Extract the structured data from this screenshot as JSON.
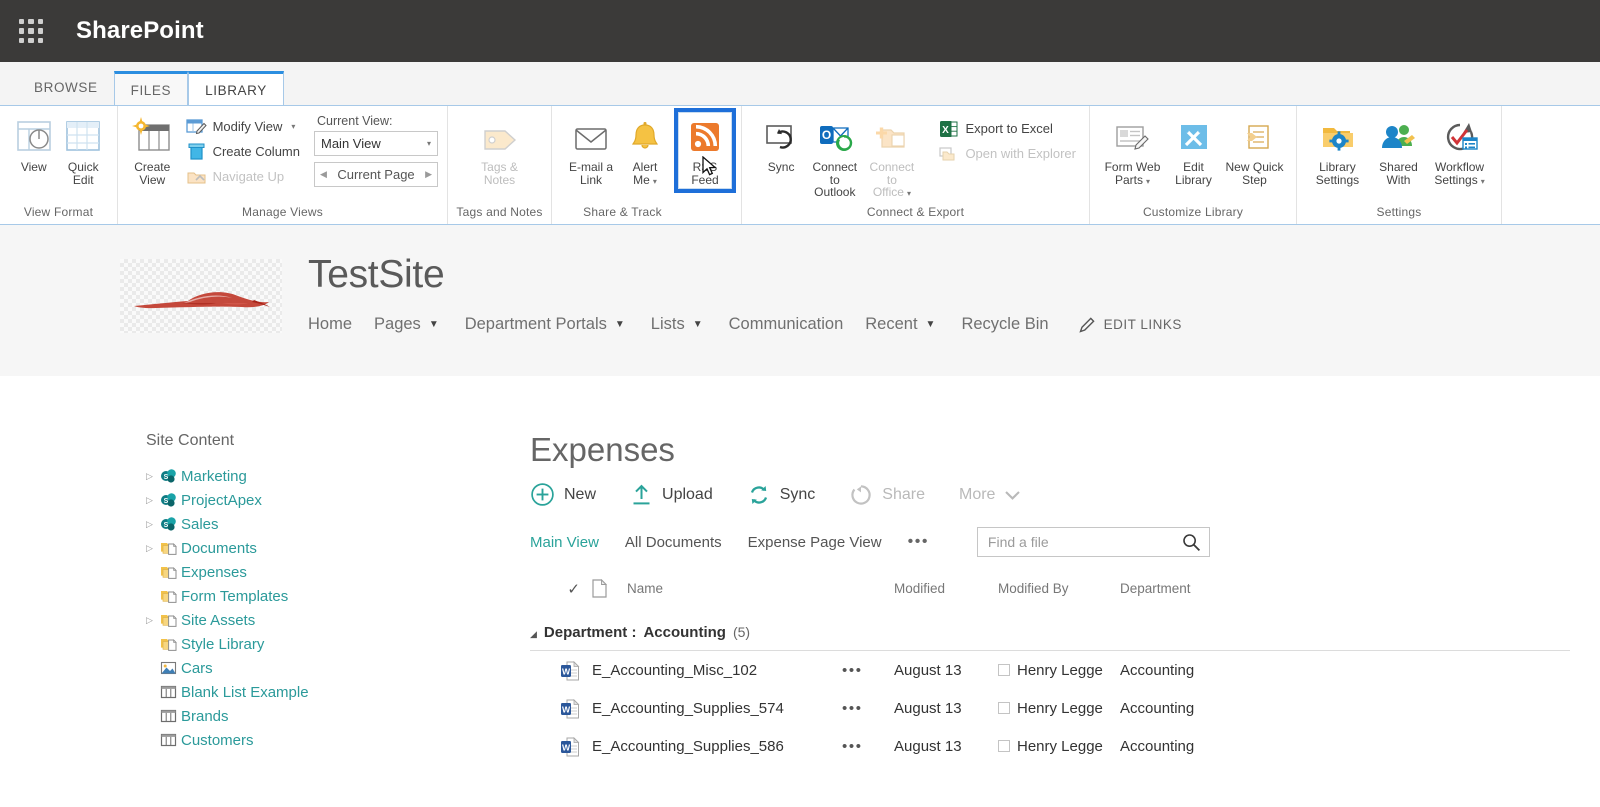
{
  "suite": {
    "waffle_icon": "app-launcher-icon",
    "title": "SharePoint"
  },
  "ribbon_tabs": [
    {
      "label": "BROWSE",
      "state": "inactive"
    },
    {
      "label": "FILES",
      "state": "secondary"
    },
    {
      "label": "LIBRARY",
      "state": "active"
    }
  ],
  "ribbon": {
    "groups": [
      {
        "label": "View Format",
        "buttons": [
          {
            "label": "View",
            "icon": "view-icon"
          },
          {
            "label": "Quick\nEdit",
            "line1": "Quick",
            "line2": "Edit",
            "icon": "quick-edit-icon"
          }
        ]
      },
      {
        "label": "Manage Views",
        "buttons": [
          {
            "line1": "Create",
            "line2": "View",
            "icon": "create-view-icon"
          }
        ],
        "small_buttons": [
          {
            "label": "Modify View",
            "icon": "modify-view-icon",
            "has_caret": true,
            "disabled": false
          },
          {
            "label": "Create Column",
            "icon": "create-column-icon",
            "has_caret": false,
            "disabled": false
          },
          {
            "label": "Navigate Up",
            "icon": "navigate-up-icon",
            "has_caret": false,
            "disabled": true
          }
        ],
        "current_view_label": "Current View:",
        "current_view_value": "Main View",
        "pager_label": "Current Page"
      },
      {
        "label": "Tags and Notes",
        "buttons": [
          {
            "line1": "Tags &",
            "line2": "Notes",
            "icon": "tags-notes-icon",
            "disabled": true
          }
        ]
      },
      {
        "label": "Share & Track",
        "buttons": [
          {
            "line1": "E-mail a",
            "line2": "Link",
            "icon": "email-link-icon"
          },
          {
            "line1": "Alert",
            "line2": "Me",
            "icon": "alert-me-icon",
            "has_caret": true
          },
          {
            "line1": "RSS",
            "line2": "Feed",
            "icon": "rss-feed-icon",
            "selected": true
          }
        ]
      },
      {
        "label": "Connect & Export",
        "buttons": [
          {
            "label": "Sync",
            "icon": "sync-icon"
          },
          {
            "line1": "Connect to",
            "line2": "Outlook",
            "icon": "connect-outlook-icon"
          },
          {
            "line1": "Connect to",
            "line2": "Office",
            "icon": "connect-office-icon",
            "has_caret": true,
            "disabled": true
          }
        ],
        "small_buttons": [
          {
            "label": "Export to Excel",
            "icon": "excel-icon",
            "disabled": false
          },
          {
            "label": "Open with Explorer",
            "icon": "explorer-icon",
            "disabled": true
          }
        ]
      },
      {
        "label": "Customize Library",
        "buttons": [
          {
            "line1": "Form Web",
            "line2": "Parts",
            "icon": "form-web-parts-icon",
            "has_caret": true
          },
          {
            "line1": "Edit",
            "line2": "Library",
            "icon": "edit-library-icon"
          },
          {
            "line1": "New Quick",
            "line2": "Step",
            "icon": "new-quick-step-icon"
          }
        ]
      },
      {
        "label": "Settings",
        "buttons": [
          {
            "line1": "Library",
            "line2": "Settings",
            "icon": "library-settings-icon"
          },
          {
            "line1": "Shared",
            "line2": "With",
            "icon": "shared-with-icon"
          },
          {
            "line1": "Workflow",
            "line2": "Settings",
            "icon": "workflow-settings-icon",
            "has_caret": true
          }
        ]
      }
    ]
  },
  "site": {
    "logo_icon": "car-silhouette-logo",
    "title": "TestSite",
    "nav": [
      {
        "label": "Home",
        "has_dropdown": false
      },
      {
        "label": "Pages",
        "has_dropdown": true
      },
      {
        "label": "Department Portals",
        "has_dropdown": true
      },
      {
        "label": "Lists",
        "has_dropdown": true
      },
      {
        "label": "Communication",
        "has_dropdown": false
      },
      {
        "label": "Recent",
        "has_dropdown": true
      },
      {
        "label": "Recycle Bin",
        "has_dropdown": false
      }
    ],
    "edit_links": "EDIT LINKS",
    "edit_links_icon": "pencil-icon"
  },
  "quicklaunch": {
    "title": "Site Content",
    "items": [
      {
        "label": "Marketing",
        "icon": "sharepoint-site-icon",
        "twisty": true
      },
      {
        "label": "ProjectApex",
        "icon": "sharepoint-site-icon",
        "twisty": true
      },
      {
        "label": "Sales",
        "icon": "sharepoint-site-icon",
        "twisty": true
      },
      {
        "label": "Documents",
        "icon": "document-library-icon",
        "twisty": true
      },
      {
        "label": "Expenses",
        "icon": "document-library-icon",
        "twisty": false
      },
      {
        "label": "Form Templates",
        "icon": "document-library-icon",
        "twisty": false
      },
      {
        "label": "Site Assets",
        "icon": "document-library-icon",
        "twisty": true
      },
      {
        "label": "Style Library",
        "icon": "document-library-icon",
        "twisty": false
      },
      {
        "label": "Cars",
        "icon": "picture-library-icon",
        "twisty": false
      },
      {
        "label": "Blank List Example",
        "icon": "list-icon",
        "twisty": false
      },
      {
        "label": "Brands",
        "icon": "list-icon",
        "twisty": false
      },
      {
        "label": "Customers",
        "icon": "list-icon",
        "twisty": false
      }
    ]
  },
  "list": {
    "title": "Expenses",
    "commands": [
      {
        "label": "New",
        "icon": "plus-circle-icon",
        "disabled": false
      },
      {
        "label": "Upload",
        "icon": "upload-icon",
        "disabled": false
      },
      {
        "label": "Sync",
        "icon": "sync-arrows-icon",
        "disabled": false
      },
      {
        "label": "Share",
        "icon": "share-icon",
        "disabled": true
      },
      {
        "label": "More",
        "icon": "chevron-down-icon",
        "disabled": true
      }
    ],
    "views": [
      {
        "label": "Main View",
        "selected": true
      },
      {
        "label": "All Documents",
        "selected": false
      },
      {
        "label": "Expense Page View",
        "selected": false
      }
    ],
    "views_overflow": "•••",
    "search": {
      "placeholder": "Find a file",
      "value": "",
      "icon": "search-icon"
    },
    "columns": {
      "check": "✓",
      "type_icon": "document-type-icon",
      "name": "Name",
      "modified": "Modified",
      "modified_by": "Modified By",
      "department": "Department"
    },
    "group": {
      "prefix": "Department : ",
      "value": "Accounting",
      "count": "(5)",
      "expanded": true
    },
    "rows": [
      {
        "icon": "word-document-icon",
        "name": "E_Accounting_Misc_102",
        "dots": "•••",
        "modified": "August 13",
        "modified_by": "Henry Legge",
        "department": "Accounting"
      },
      {
        "icon": "word-document-icon",
        "name": "E_Accounting_Supplies_574",
        "dots": "•••",
        "modified": "August 13",
        "modified_by": "Henry Legge",
        "department": "Accounting"
      },
      {
        "icon": "word-document-icon",
        "name": "E_Accounting_Supplies_586",
        "dots": "•••",
        "modified": "August 13",
        "modified_by": "Henry Legge",
        "department": "Accounting"
      }
    ]
  },
  "colors": {
    "suitebar_bg": "#3b3a39",
    "ribbon_border": "#a7c9e8",
    "selection_blue": "#1e6fd9",
    "link_teal": "#2b9a9a",
    "accent_teal": "#2aa39a",
    "logo_red": "#c0392b"
  }
}
